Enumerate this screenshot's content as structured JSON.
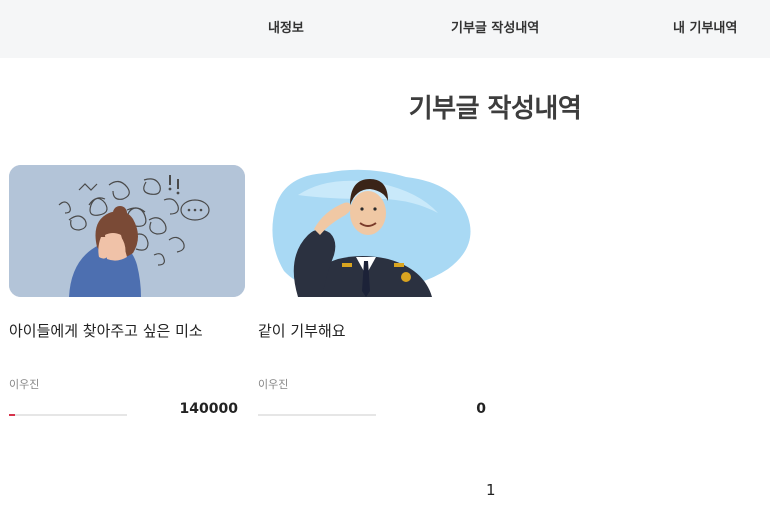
{
  "nav": {
    "items": [
      {
        "label": "내정보"
      },
      {
        "label": "기부글 작성내역"
      },
      {
        "label": "내 기부내역"
      }
    ]
  },
  "page": {
    "title": "기부글 작성내역"
  },
  "cards": [
    {
      "title": "아이들에게 찾아주고 싶은 미소",
      "author": "이우진",
      "amount": "140000",
      "progress_fraction": 0.05,
      "image": "woman-stressed-illustration",
      "image_bg": "#b3c4d8"
    },
    {
      "title": "같이 기부해요",
      "author": "이우진",
      "amount": "0",
      "progress_fraction": 0,
      "image": "police-officer-saluting-illustration",
      "image_bg": "#ffffff"
    }
  ],
  "pagination": {
    "current": "1"
  },
  "colors": {
    "nav_bg": "#f5f6f7",
    "progress": "#d6334b",
    "track": "#e6e6e6"
  }
}
